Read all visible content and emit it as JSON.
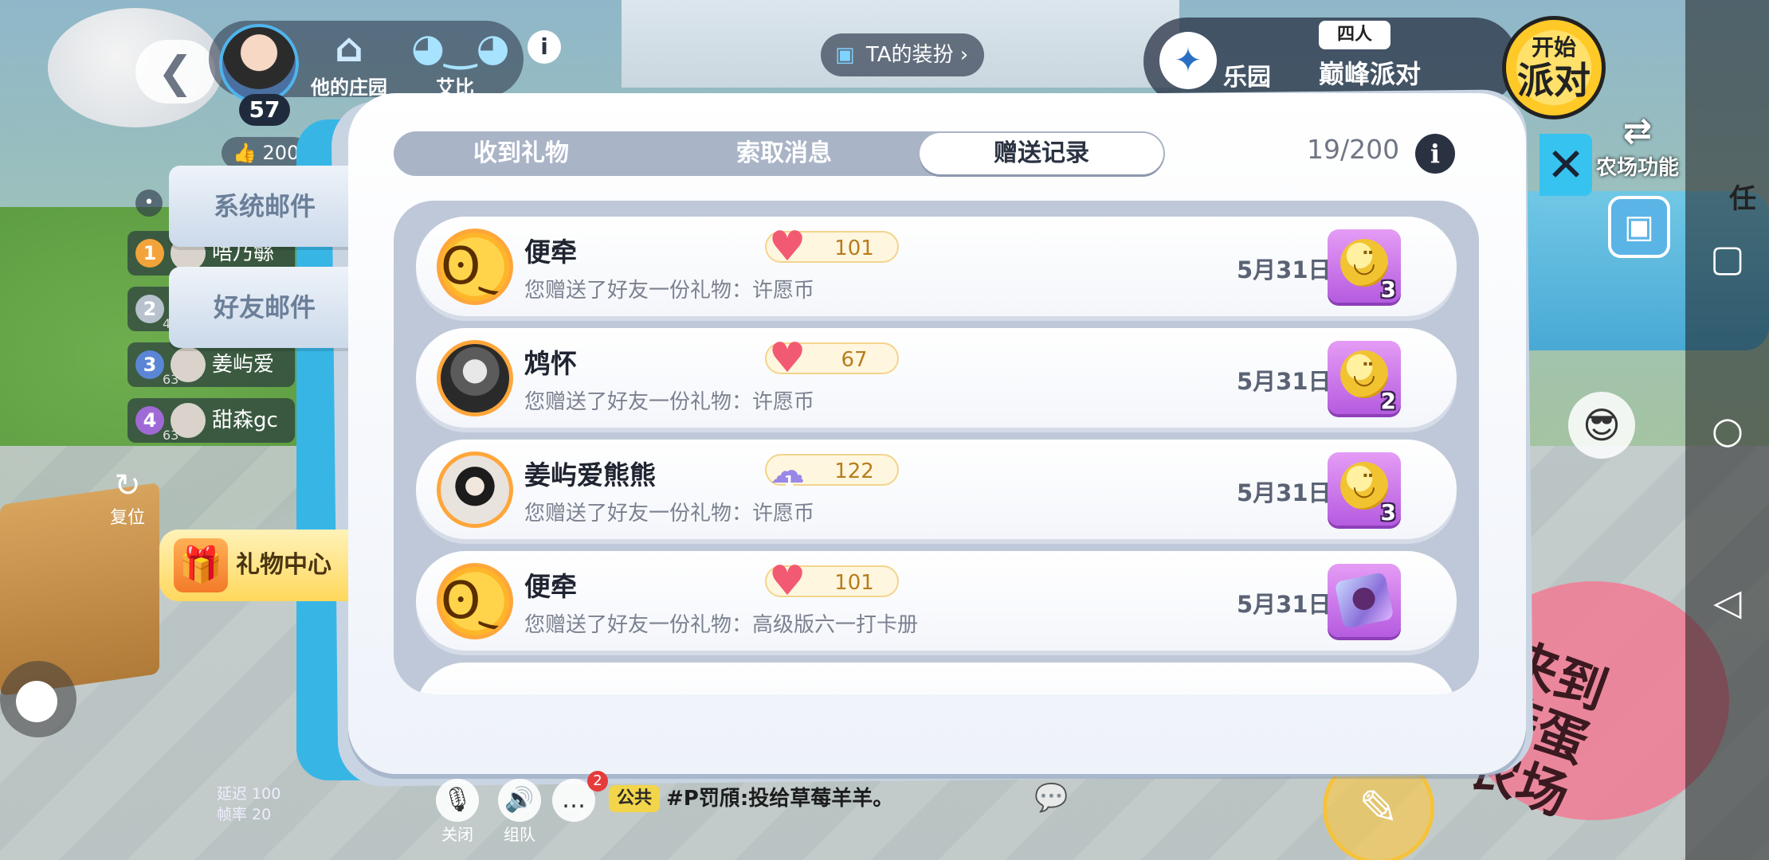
{
  "hud": {
    "level": "57",
    "manor_label": "他的庄园",
    "pet_label": "艾比",
    "likes": "200",
    "outfit_label": "TA的装扮",
    "paradise_label": "乐园",
    "party_size": "四人",
    "party_label": "巅峰派对",
    "start_party_line1": "开始",
    "start_party_line2": "派对",
    "farm_function_label": "农场功能",
    "reset_label": "复位",
    "latency": "延迟 100",
    "framerate": "帧率 20",
    "mute_label": "关闭",
    "team_label": "组队",
    "chat_badge": "2",
    "public_tag": "公共",
    "public_message": "#P罚頎:投给草莓羊羊。",
    "right_edge_text": "任"
  },
  "ranks": [
    {
      "num": "1",
      "name": "唔乃緐",
      "level": "",
      "color": "#f2a33a"
    },
    {
      "num": "2",
      "name": "",
      "level": "47",
      "color": "#b7c2cc"
    },
    {
      "num": "3",
      "name": "姜屿爱",
      "level": "63",
      "color": "#5b86d6"
    },
    {
      "num": "4",
      "name": "甜森gc",
      "level": "63",
      "color": "#a06ad6"
    }
  ],
  "side_tabs": {
    "system_mail": "系统邮件",
    "friend_mail": "好友邮件",
    "gift_center": "礼物中心"
  },
  "modal": {
    "tabs": [
      "收到礼物",
      "索取消息",
      "赠送记录"
    ],
    "active_tab": "赠送记录",
    "counter": "19/200",
    "info_glyph": "i",
    "close_glyph": "✕"
  },
  "records": [
    {
      "name": "便牵",
      "intimacy_icon": "heart-icon",
      "intimacy_level": "",
      "intimacy": "101",
      "desc": "您赠送了好友一份礼物：许愿币",
      "date": "5月31日",
      "gift_type": "wish-coin",
      "qty": "3",
      "avatar": "smiley"
    },
    {
      "name": "鸩怀",
      "intimacy_icon": "heart-icon",
      "intimacy_level": "",
      "intimacy": "67",
      "desc": "您赠送了好友一份礼物：许愿币",
      "date": "5月31日",
      "gift_type": "wish-coin",
      "qty": "2",
      "avatar": "photo-dark"
    },
    {
      "name": "姜屿爱熊熊",
      "intimacy_icon": "cloud-icon",
      "intimacy_level": "1",
      "intimacy": "122",
      "desc": "您赠送了好友一份礼物：许愿币",
      "date": "5月31日",
      "gift_type": "wish-coin",
      "qty": "3",
      "avatar": "photo-girl"
    },
    {
      "name": "便牵",
      "intimacy_icon": "heart-icon",
      "intimacy_level": "",
      "intimacy": "101",
      "desc": "您赠送了好友一份礼物：高级版六一打卡册",
      "date": "5月31日",
      "gift_type": "checkin-album",
      "qty": "",
      "avatar": "smiley"
    }
  ],
  "colors": {
    "accent_blue": "#36c3ef",
    "heart": "#f25a72",
    "gift_tile": "#b55be0",
    "avatar_ring": "#ffa63a"
  }
}
